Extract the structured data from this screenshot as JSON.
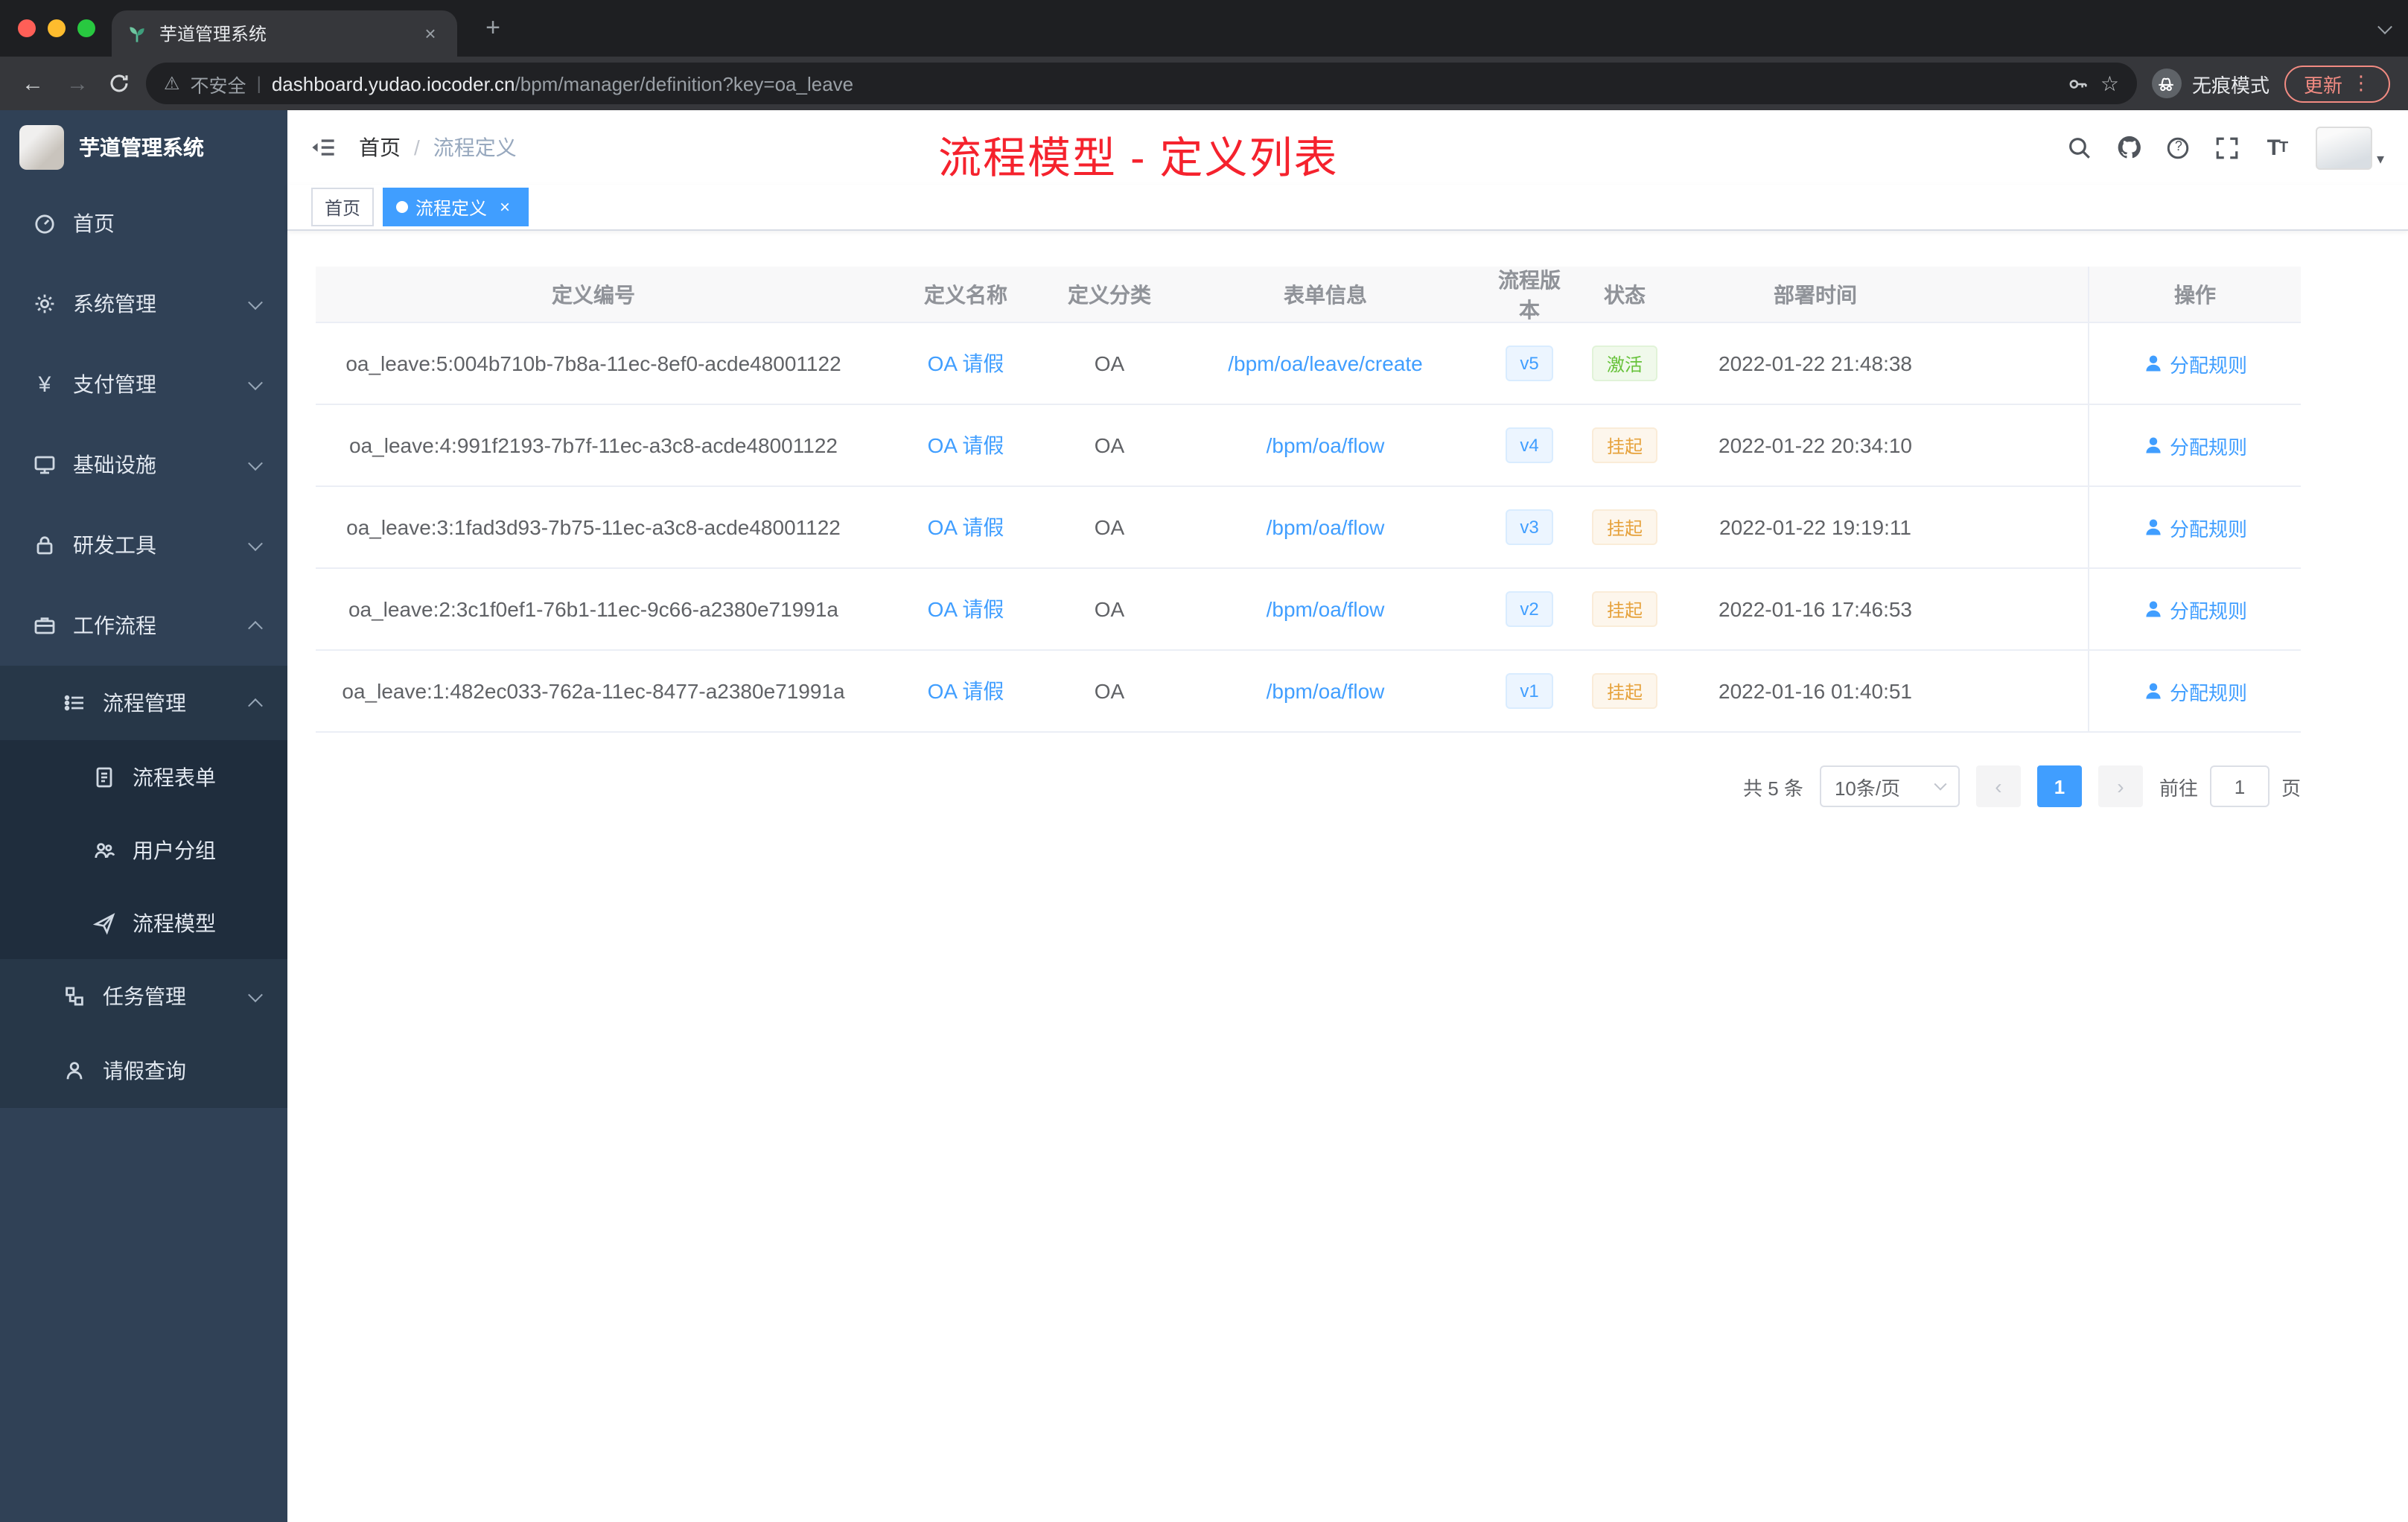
{
  "browser": {
    "tab_title": "芋道管理系统",
    "security_label": "不安全",
    "url_host": "dashboard.yudao.iocoder.cn",
    "url_path": "/bpm/manager/definition?key=oa_leave",
    "incognito_label": "无痕模式",
    "update_label": "更新"
  },
  "glyphs": {
    "close": "×",
    "plus": "+",
    "back": "←",
    "forward": "→",
    "star": "☆",
    "warning": "⚠",
    "pipe": "|",
    "kebab": "⋮",
    "yen": "¥",
    "question": "?",
    "font_big": "T",
    "font_small": "T",
    "prev": "‹",
    "next": "›",
    "caret_down": "▾"
  },
  "sidebar": {
    "logo_title": "芋道管理系统",
    "items": [
      {
        "label": "首页"
      },
      {
        "label": "系统管理"
      },
      {
        "label": "支付管理"
      },
      {
        "label": "基础设施"
      },
      {
        "label": "研发工具"
      },
      {
        "label": "工作流程"
      },
      {
        "label": "流程管理"
      },
      {
        "label": "流程表单"
      },
      {
        "label": "用户分组"
      },
      {
        "label": "流程模型"
      },
      {
        "label": "任务管理"
      },
      {
        "label": "请假查询"
      }
    ]
  },
  "header": {
    "breadcrumb": {
      "home": "首页",
      "separator": "/",
      "current": "流程定义"
    },
    "annotation": "流程模型 - 定义列表"
  },
  "tags": {
    "home": "首页",
    "active": "流程定义"
  },
  "table": {
    "columns": [
      "定义编号",
      "定义名称",
      "定义分类",
      "表单信息",
      "流程版本",
      "状态",
      "部署时间",
      "操作"
    ],
    "rows": [
      {
        "id": "oa_leave:5:004b710b-7b8a-11ec-8ef0-acde48001122",
        "name": "OA 请假",
        "category": "OA",
        "form": "/bpm/oa/leave/create",
        "version": "v5",
        "status": "激活",
        "status_type": "success",
        "deploy_time": "2022-01-22 21:48:38",
        "action": "分配规则"
      },
      {
        "id": "oa_leave:4:991f2193-7b7f-11ec-a3c8-acde48001122",
        "name": "OA 请假",
        "category": "OA",
        "form": "/bpm/oa/flow",
        "version": "v4",
        "status": "挂起",
        "status_type": "warning",
        "deploy_time": "2022-01-22 20:34:10",
        "action": "分配规则"
      },
      {
        "id": "oa_leave:3:1fad3d93-7b75-11ec-a3c8-acde48001122",
        "name": "OA 请假",
        "category": "OA",
        "form": "/bpm/oa/flow",
        "version": "v3",
        "status": "挂起",
        "status_type": "warning",
        "deploy_time": "2022-01-22 19:19:11",
        "action": "分配规则"
      },
      {
        "id": "oa_leave:2:3c1f0ef1-76b1-11ec-9c66-a2380e71991a",
        "name": "OA 请假",
        "category": "OA",
        "form": "/bpm/oa/flow",
        "version": "v2",
        "status": "挂起",
        "status_type": "warning",
        "deploy_time": "2022-01-16 17:46:53",
        "action": "分配规则"
      },
      {
        "id": "oa_leave:1:482ec033-762a-11ec-8477-a2380e71991a",
        "name": "OA 请假",
        "category": "OA",
        "form": "/bpm/oa/flow",
        "version": "v1",
        "status": "挂起",
        "status_type": "warning",
        "deploy_time": "2022-01-16 01:40:51",
        "action": "分配规则"
      }
    ]
  },
  "pagination": {
    "total": "共 5 条",
    "page_size": "10条/页",
    "page": "1",
    "goto_label": "前往",
    "goto_value": "1",
    "page_unit": "页"
  }
}
